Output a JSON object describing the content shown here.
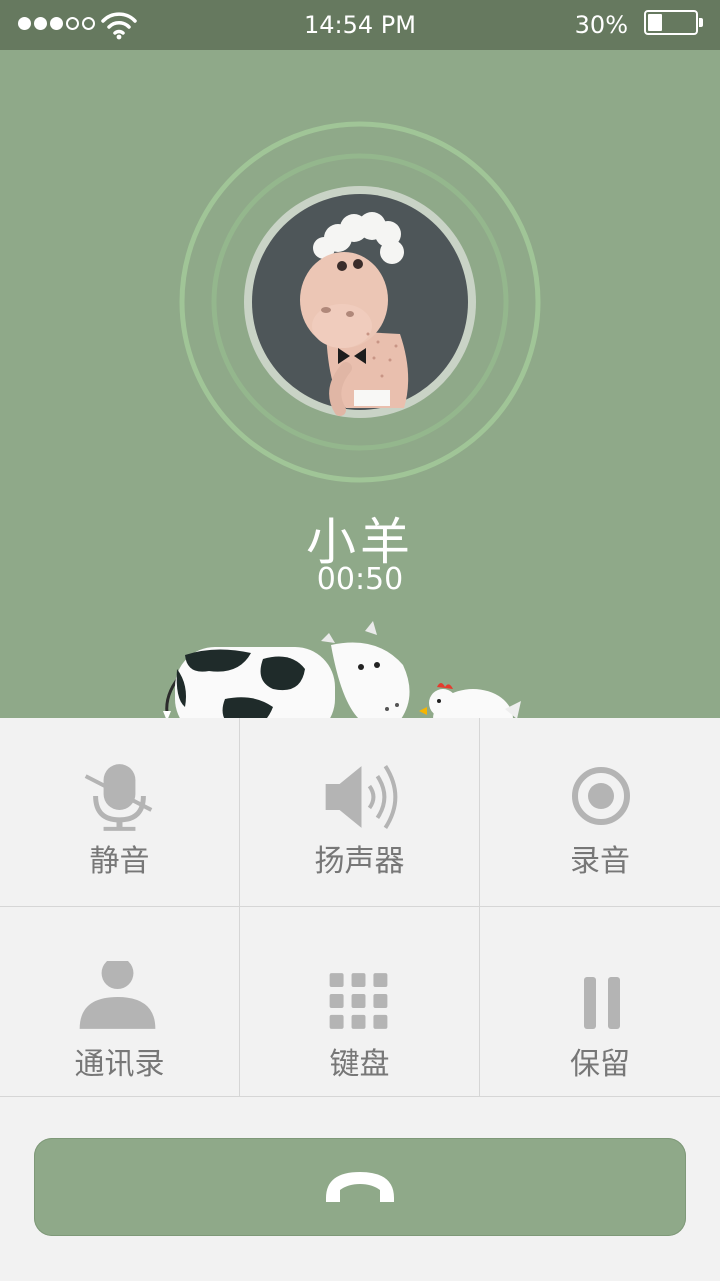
{
  "status_bar": {
    "signal_bars_filled": 3,
    "signal_bars_total": 5,
    "wifi_icon": "wifi-icon",
    "time": "14:54 PM",
    "battery_percent_label": "30%",
    "battery_level": 0.3
  },
  "call": {
    "caller_name": "小羊",
    "duration": "00:50",
    "avatar_icon": "sheep-avatar-icon"
  },
  "actions": [
    {
      "label": "静音",
      "icon": "microphone-muted-icon"
    },
    {
      "label": "扬声器",
      "icon": "speaker-icon"
    },
    {
      "label": "录音",
      "icon": "record-icon"
    },
    {
      "label": "通讯录",
      "icon": "contact-icon"
    },
    {
      "label": "键盘",
      "icon": "keypad-icon"
    },
    {
      "label": "保留",
      "icon": "pause-icon"
    }
  ],
  "end_call": {
    "icon": "hang-up-icon"
  },
  "colors": {
    "status_bar_bg": "#66795f",
    "hero_bg": "#8fa989",
    "ring": "#9cc793",
    "icon_gray": "#b4b4b4",
    "label_gray": "#777777"
  }
}
